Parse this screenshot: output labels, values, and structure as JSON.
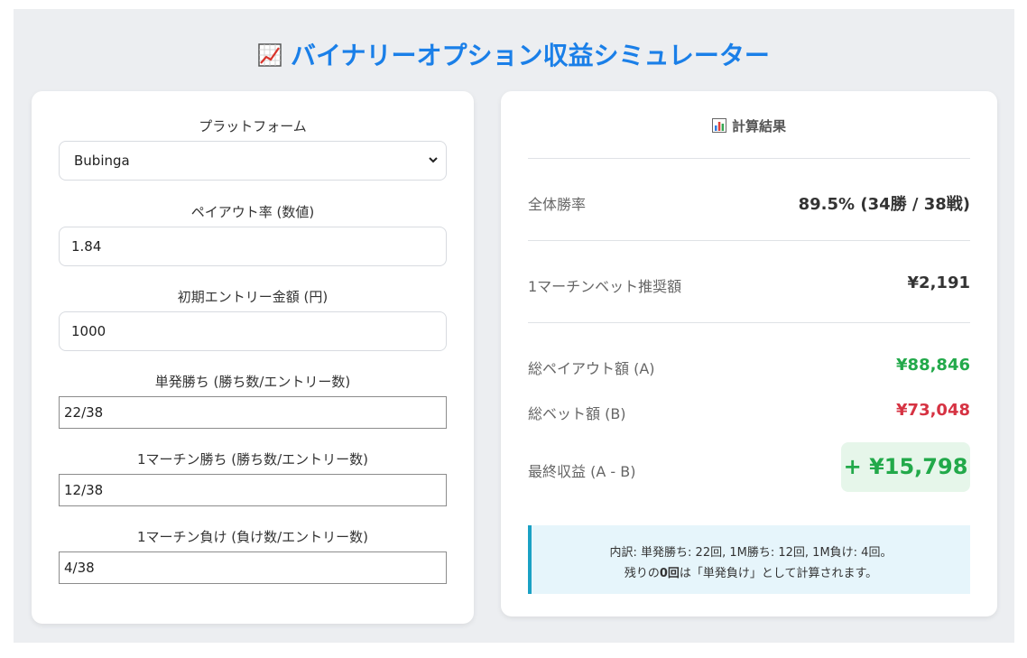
{
  "header": {
    "title": "バイナリーオプション収益シミュレーター",
    "icon": "chart-increasing-icon"
  },
  "form": {
    "platform": {
      "label": "プラットフォーム",
      "selected": "Bubinga"
    },
    "payout": {
      "label": "ペイアウト率 (数値)",
      "value": "1.84"
    },
    "entry": {
      "label": "初期エントリー金額 (円)",
      "value": "1000"
    },
    "single_win": {
      "label": "単発勝ち (勝ち数/エントリー数)",
      "value": "22/38"
    },
    "martin_win": {
      "label": "1マーチン勝ち (勝ち数/エントリー数)",
      "value": "12/38"
    },
    "martin_loss": {
      "label": "1マーチン負け (負け数/エントリー数)",
      "value": "4/38"
    }
  },
  "results": {
    "title": "計算結果",
    "icon": "bar-chart-icon",
    "win_rate": {
      "label": "全体勝率",
      "value": "89.5% (34勝 / 38戦)"
    },
    "martin_bet": {
      "label": "1マーチンベット推奨額",
      "value": "¥2,191"
    },
    "total_payout": {
      "label": "総ペイアウト額 (A)",
      "value": "¥88,846"
    },
    "total_bet": {
      "label": "総ベット額 (B)",
      "value": "¥73,048"
    },
    "final_profit": {
      "label": "最終収益 (A - B)",
      "value": "+ ¥15,798"
    },
    "note": {
      "line1": "内訳: 単発勝ち: 22回, 1M勝ち: 12回, 1M負け: 4回。",
      "line2_prefix": "残りの",
      "line2_bold": "0回",
      "line2_suffix": "は「単発負け」として計算されます。"
    }
  },
  "colors": {
    "accent": "#1a7fe8",
    "positive": "#22a94a",
    "negative": "#d63343",
    "note_border": "#1aa1c4"
  }
}
